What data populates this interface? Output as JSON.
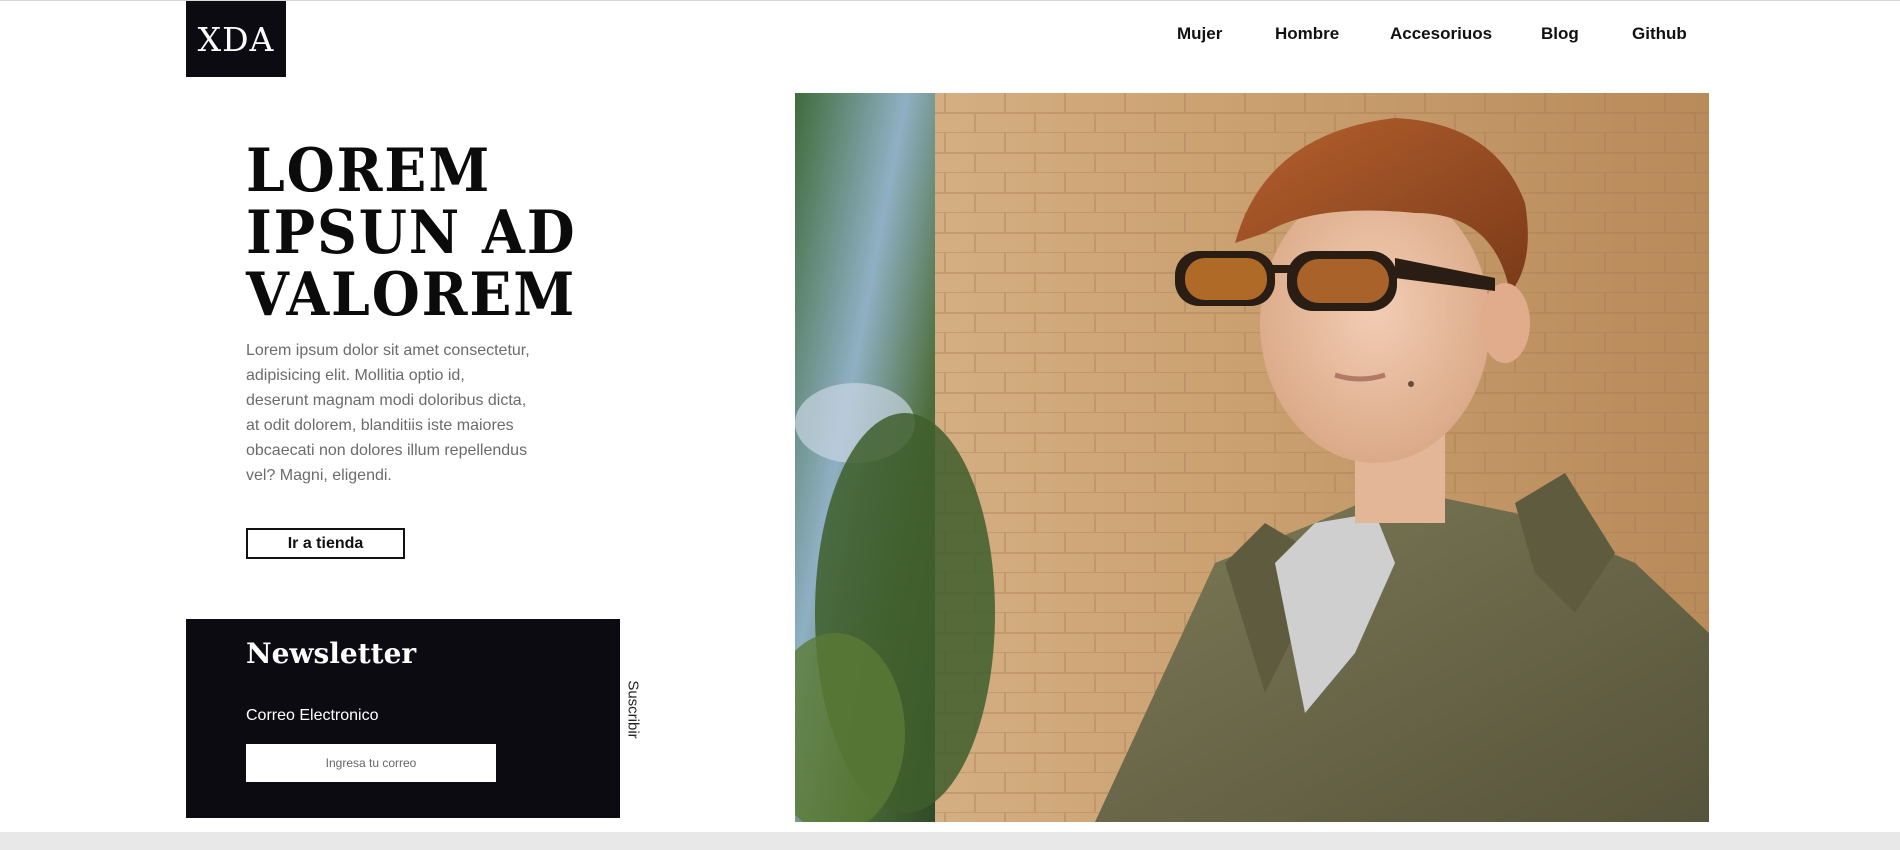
{
  "header": {
    "logo": "XDA",
    "nav": [
      {
        "label": "Mujer"
      },
      {
        "label": "Hombre"
      },
      {
        "label": "Accesoriuos"
      },
      {
        "label": "Blog"
      },
      {
        "label": "Github"
      }
    ]
  },
  "hero": {
    "title_lines": [
      "LOREM",
      "IPSUN AD",
      "VALOREM"
    ],
    "text": "Lorem ipsum dolor sit amet consectetur, adipisicing elit. Mollitia optio id, deserunt magnam modi doloribus dicta, at odit dolorem, blanditiis iste maiores obcaecati non dolores illum repellendus vel? Magni, eligendi.",
    "button_label": "Ir a tienda",
    "image_icon": "hero-photo"
  },
  "newsletter": {
    "title": "Newsletter",
    "email_label": "Correo Electronico",
    "email_placeholder": "Ingresa tu correo",
    "email_value": "",
    "subscribe_label": "Suscribir"
  },
  "colors": {
    "dark": "#0d0b12",
    "text_muted": "#6b6b6b",
    "brick": "#c99a68",
    "jacket": "#6f6c4d"
  }
}
